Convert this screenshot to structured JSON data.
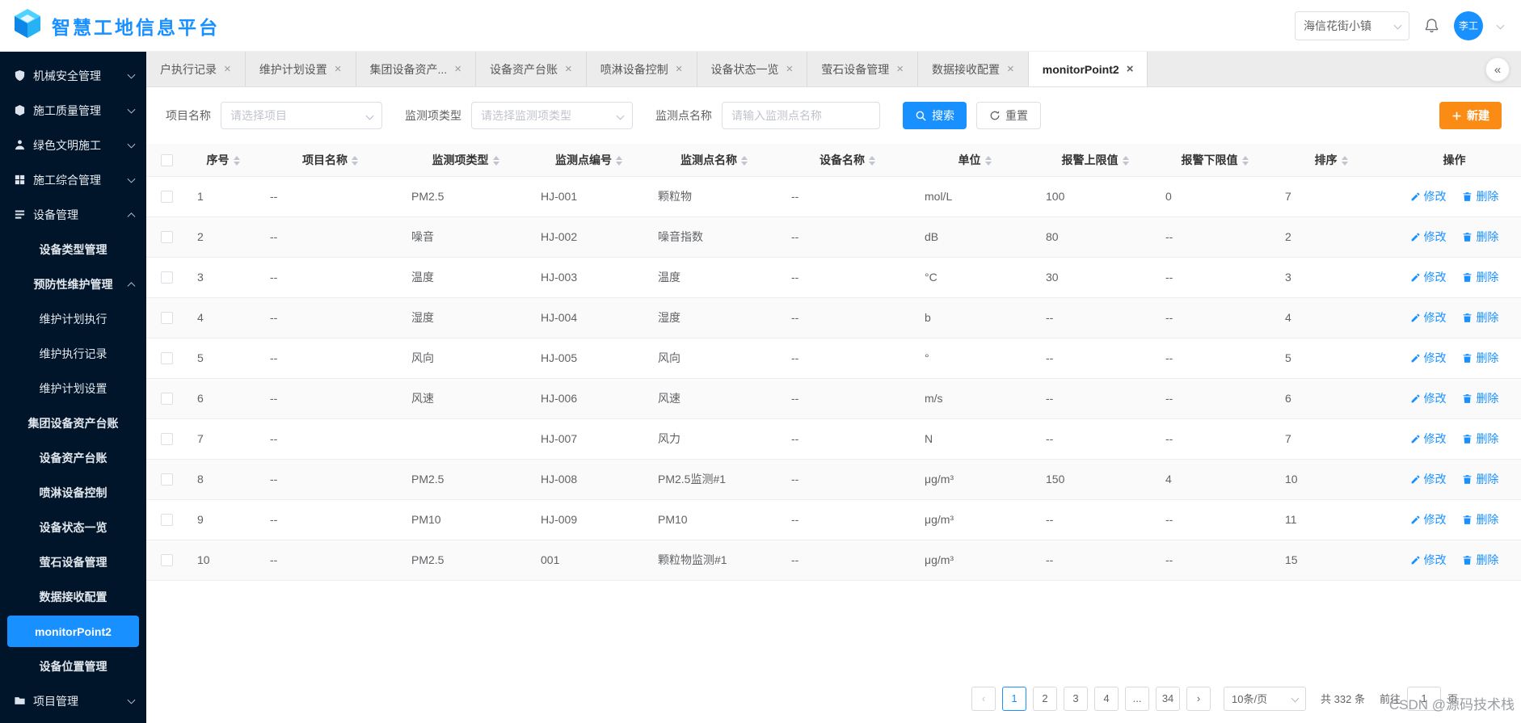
{
  "header": {
    "title": "智慧工地信息平台",
    "project_name": "海信花街小镇",
    "user_name": "李工"
  },
  "colors": {
    "primary": "#1890ff",
    "sidebar_bg": "#001529",
    "create_button_orange": "#fa8c16"
  },
  "sidebar": {
    "items": [
      {
        "label": "机械安全管理",
        "icon": "mechanical-safety",
        "level": 0,
        "chevron": "down"
      },
      {
        "label": "施工质量管理",
        "icon": "construction-quality",
        "level": 0,
        "chevron": "down"
      },
      {
        "label": "绿色文明施工",
        "icon": "green-civilization",
        "level": 0,
        "chevron": "down"
      },
      {
        "label": "施工综合管理",
        "icon": "construction-comprehensive",
        "level": 0,
        "chevron": "down"
      },
      {
        "label": "设备管理",
        "icon": "equipment-management",
        "level": 0,
        "chevron": "up"
      },
      {
        "label": "设备类型管理",
        "level": 1
      },
      {
        "label": "预防性维护管理",
        "level": 1,
        "chevron": "up"
      },
      {
        "label": "维护计划执行",
        "level": 2
      },
      {
        "label": "维护执行记录",
        "level": 2
      },
      {
        "label": "维护计划设置",
        "level": 2
      },
      {
        "label": "集团设备资产台账",
        "level": 1
      },
      {
        "label": "设备资产台账",
        "level": 1
      },
      {
        "label": "喷淋设备控制",
        "level": 1
      },
      {
        "label": "设备状态一览",
        "level": 1
      },
      {
        "label": "萤石设备管理",
        "level": 1
      },
      {
        "label": "数据接收配置",
        "level": 1
      },
      {
        "label": "monitorPoint2",
        "level": 1,
        "active": true
      },
      {
        "label": "设备位置管理",
        "level": 1
      },
      {
        "label": "项目管理",
        "icon": "project-management",
        "level": 0,
        "chevron": "down"
      }
    ]
  },
  "tabbar": {
    "close_icon": "×",
    "collapse_icon": "«",
    "tabs": [
      {
        "label": "户执行记录",
        "active": false
      },
      {
        "label": "维护计划设置",
        "active": false
      },
      {
        "label": "集团设备资产...",
        "active": false
      },
      {
        "label": "设备资产台账",
        "active": false
      },
      {
        "label": "喷淋设备控制",
        "active": false
      },
      {
        "label": "设备状态一览",
        "active": false
      },
      {
        "label": "萤石设备管理",
        "active": false
      },
      {
        "label": "数据接收配置",
        "active": false
      },
      {
        "label": "monitorPoint2",
        "active": true
      }
    ]
  },
  "filters": {
    "project_label": "项目名称",
    "project_placeholder": "请选择项目",
    "type_label": "监测项类型",
    "type_placeholder": "请选择监测项类型",
    "name_label": "监测点名称",
    "name_placeholder": "请输入监测点名称",
    "search_label": "搜索",
    "reset_label": "重置",
    "create_label": "新建"
  },
  "table": {
    "columns": [
      "序号",
      "项目名称",
      "监测项类型",
      "监测点编号",
      "监测点名称",
      "设备名称",
      "单位",
      "报警上限值",
      "报警下限值",
      "排序",
      "操作"
    ],
    "edit_label": "修改",
    "delete_label": "删除",
    "rows": [
      {
        "seq": "1",
        "project": "--",
        "type": "PM2.5",
        "code": "HJ-001",
        "name": "颗粒物",
        "device": "--",
        "unit": "mol/L",
        "upper": "100",
        "lower": "0",
        "order": "7"
      },
      {
        "seq": "2",
        "project": "--",
        "type": "噪音",
        "code": "HJ-002",
        "name": "噪音指数",
        "device": "--",
        "unit": "dB",
        "upper": "80",
        "lower": "--",
        "order": "2"
      },
      {
        "seq": "3",
        "project": "--",
        "type": "温度",
        "code": "HJ-003",
        "name": "温度",
        "device": "--",
        "unit": "°C",
        "upper": "30",
        "lower": "--",
        "order": "3"
      },
      {
        "seq": "4",
        "project": "--",
        "type": "湿度",
        "code": "HJ-004",
        "name": "湿度",
        "device": "--",
        "unit": "b",
        "upper": "--",
        "lower": "--",
        "order": "4"
      },
      {
        "seq": "5",
        "project": "--",
        "type": "风向",
        "code": "HJ-005",
        "name": "风向",
        "device": "--",
        "unit": "°",
        "upper": "--",
        "lower": "--",
        "order": "5"
      },
      {
        "seq": "6",
        "project": "--",
        "type": "风速",
        "code": "HJ-006",
        "name": "风速",
        "device": "--",
        "unit": "m/s",
        "upper": "--",
        "lower": "--",
        "order": "6"
      },
      {
        "seq": "7",
        "project": "--",
        "type": "",
        "code": "HJ-007",
        "name": "风力",
        "device": "--",
        "unit": "N",
        "upper": "--",
        "lower": "--",
        "order": "7"
      },
      {
        "seq": "8",
        "project": "--",
        "type": "PM2.5",
        "code": "HJ-008",
        "name": "PM2.5监测#1",
        "device": "--",
        "unit": "μg/m³",
        "upper": "150",
        "lower": "4",
        "order": "10"
      },
      {
        "seq": "9",
        "project": "--",
        "type": "PM10",
        "code": "HJ-009",
        "name": "PM10",
        "device": "--",
        "unit": "μg/m³",
        "upper": "--",
        "lower": "--",
        "order": "11"
      },
      {
        "seq": "10",
        "project": "--",
        "type": "PM2.5",
        "code": "001",
        "name": "颗粒物监测#1",
        "device": "--",
        "unit": "μg/m³",
        "upper": "--",
        "lower": "--",
        "order": "15"
      }
    ]
  },
  "pagination": {
    "prev_icon": "‹",
    "next_icon": "›",
    "pages": [
      "1",
      "2",
      "3",
      "4",
      "...",
      "34"
    ],
    "active_page": "1",
    "page_size": "10条/页",
    "total_text": "共 332 条",
    "jump_prefix": "前往",
    "jump_value": "1",
    "jump_suffix": "页"
  },
  "watermark": "CSDN @源码技术栈"
}
